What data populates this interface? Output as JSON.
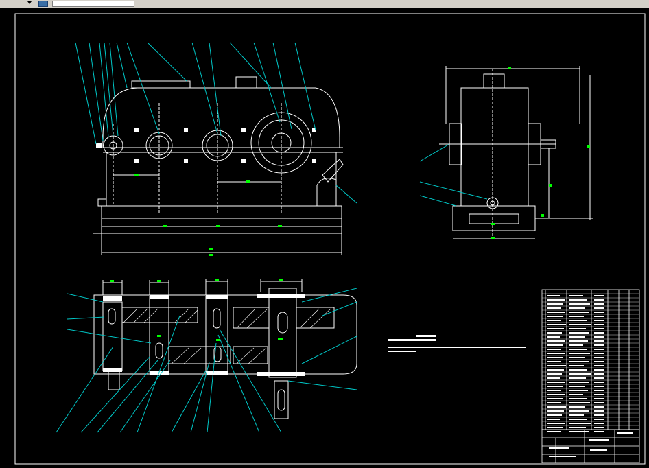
{
  "toolbar": {
    "dropdown_value": "",
    "layer_name": ""
  },
  "drawing": {
    "title": "",
    "note_lines": [
      "",
      "",
      ""
    ]
  },
  "colors": {
    "background": "#000000",
    "geometry": "#ffffff",
    "leaders": "#00c8c8",
    "dimensions": "#00ff00",
    "hatch": "#ffffff"
  }
}
